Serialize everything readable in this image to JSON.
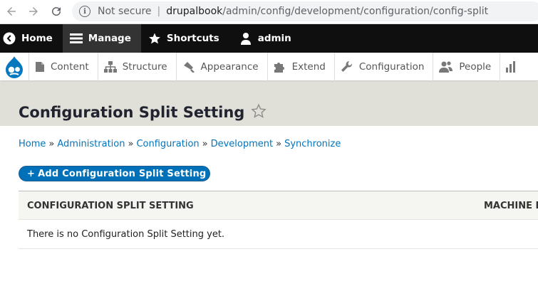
{
  "browser": {
    "not_secure": "Not secure",
    "url_host": "drupalbook",
    "url_path": "/admin/config/development/configuration/config-split",
    "separator": "|"
  },
  "toolbar": {
    "items": [
      {
        "label": "Home",
        "icon": "chevron-left-icon"
      },
      {
        "label": "Manage",
        "icon": "menu-icon"
      },
      {
        "label": "Shortcuts",
        "icon": "star-icon"
      },
      {
        "label": "admin",
        "icon": "user-icon"
      }
    ]
  },
  "tray": {
    "items": [
      {
        "label": "Content",
        "icon": "document-icon"
      },
      {
        "label": "Structure",
        "icon": "structure-icon"
      },
      {
        "label": "Appearance",
        "icon": "brush-icon"
      },
      {
        "label": "Extend",
        "icon": "puzzle-icon"
      },
      {
        "label": "Configuration",
        "icon": "wrench-icon"
      },
      {
        "label": "People",
        "icon": "people-icon"
      }
    ]
  },
  "page": {
    "title": "Configuration Split Setting"
  },
  "breadcrumb": {
    "separator": "»",
    "items": [
      "Home",
      "Administration",
      "Configuration",
      "Development",
      "Synchronize"
    ]
  },
  "actions": {
    "plus": "+",
    "add_label": "Add Configuration Split Setting"
  },
  "table": {
    "headers": [
      "Configuration Split Setting",
      "Machine n"
    ],
    "empty_message": "There is no Configuration Split Setting yet."
  },
  "colors": {
    "link": "#0074bd",
    "primary_button": "#0071b8",
    "toolbar": "#0f0f0f",
    "header_bg": "#e0e0d8"
  }
}
